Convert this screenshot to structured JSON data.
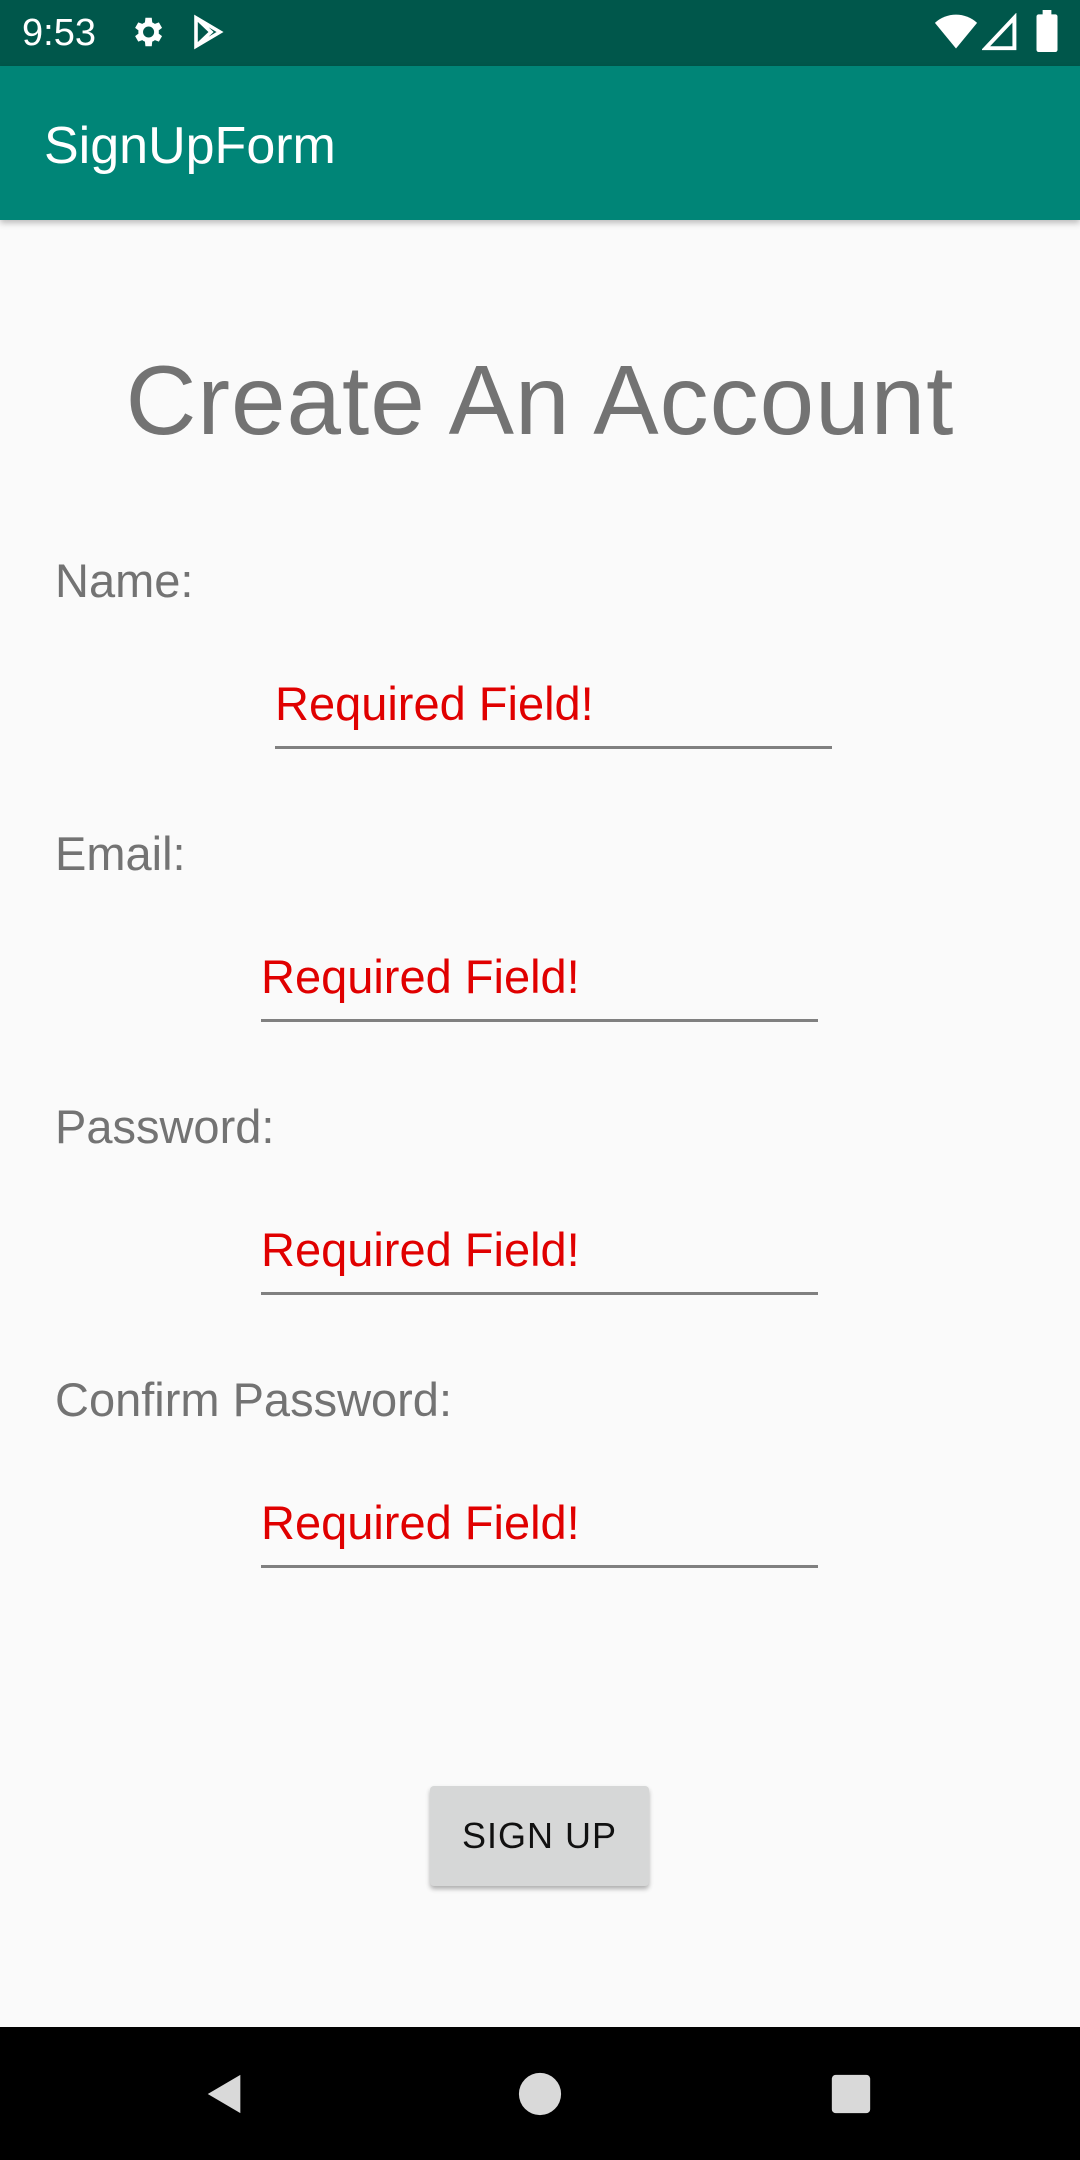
{
  "status_bar": {
    "time": "9:53",
    "icons": [
      "gear-icon",
      "play-store-icon",
      "wifi-icon",
      "signal-icon",
      "battery-icon"
    ]
  },
  "app_bar": {
    "title": "SignUpForm"
  },
  "form": {
    "heading": "Create An Account",
    "fields": [
      {
        "label": "Name:",
        "error": "Required Field!"
      },
      {
        "label": "Email:",
        "error": "Required Field!"
      },
      {
        "label": "Password:",
        "error": "Required Field!"
      },
      {
        "label": "Confirm Password:",
        "error": "Required Field!"
      }
    ],
    "submit_label": "SIGN UP"
  },
  "nav_bar": {
    "icons": [
      "back-icon",
      "home-icon",
      "recents-icon"
    ]
  },
  "colors": {
    "status_bar": "#00574b",
    "app_bar": "#008577",
    "error_text": "#e00000",
    "label_text": "#737373",
    "button_bg": "#d6d7d7"
  }
}
